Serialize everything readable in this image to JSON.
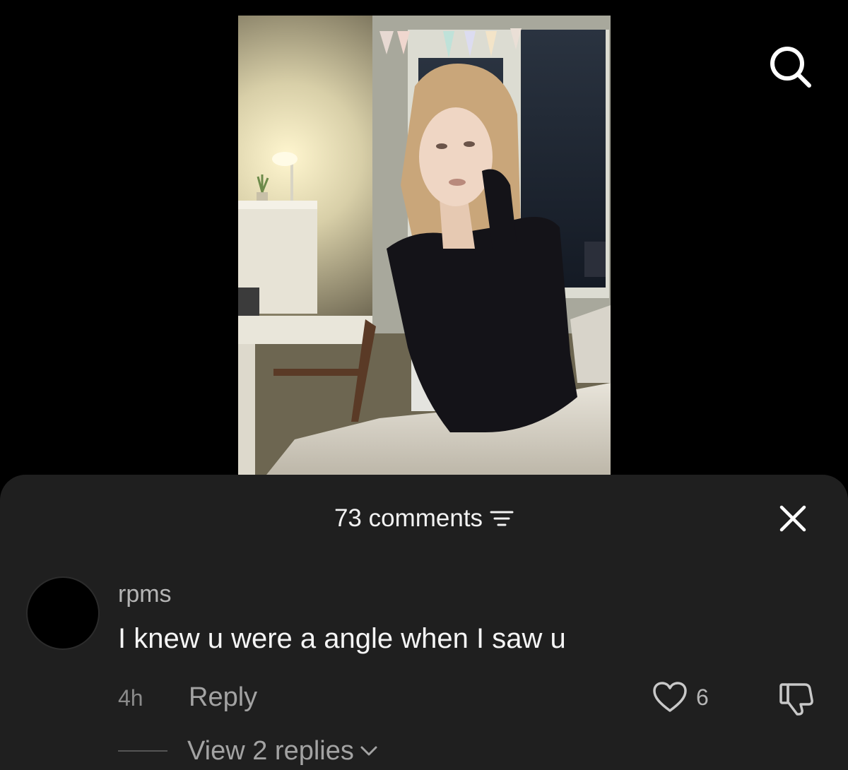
{
  "header": {
    "search_icon": "search-icon"
  },
  "video": {
    "description_hidden": true
  },
  "comments_sheet": {
    "count_label": "73 comments",
    "sort_icon": "filter-lines-icon",
    "close_icon": "close-icon"
  },
  "comment": {
    "username": "rpms",
    "text": "I knew u were a angle when I saw u",
    "time": "4h",
    "reply_label": "Reply",
    "likes": "6",
    "view_replies_label": "View 2 replies"
  },
  "colors": {
    "background": "#000000",
    "sheet": "#1f1f1f",
    "text_primary": "#f5f5f5",
    "text_secondary": "#a3a3a3"
  }
}
